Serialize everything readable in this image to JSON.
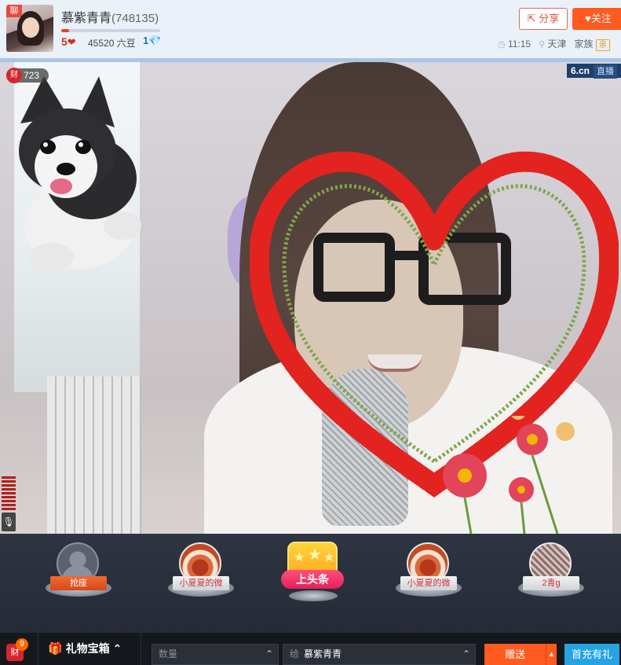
{
  "header": {
    "avatar_badge": "聊",
    "anchor_name": "慕紫青青",
    "anchor_id": "(748135)",
    "level": "5",
    "level_progress": 0.08,
    "beans": "45520 六豆",
    "diamond_level": "1",
    "share_label": "分享",
    "follow_label": "关注",
    "time": "11:15",
    "city": "天津",
    "family_label": "家族",
    "family_tag": "亲"
  },
  "video": {
    "watermark_logo": "6.cn",
    "watermark_live": "直播",
    "fortune_icon": "财",
    "fortune_count": "723"
  },
  "seats": [
    {
      "label": "抢座"
    },
    {
      "label": "小夏夏的微"
    },
    {
      "label": "上头条"
    },
    {
      "label": "小夏夏的微"
    },
    {
      "label": "2青g"
    }
  ],
  "toolbar": {
    "fortune_icon": "财",
    "fortune_badge": "9",
    "gift_box_label": "礼物宝箱",
    "quantity_placeholder": "数量",
    "to_prefix": "给",
    "to_name": "慕紫青青",
    "send_label": "赠送",
    "recharge_label": "首充有礼"
  },
  "colors": {
    "accent": "#ff5a1f",
    "recharge": "#27a3e3",
    "heart": "#e3231f"
  }
}
